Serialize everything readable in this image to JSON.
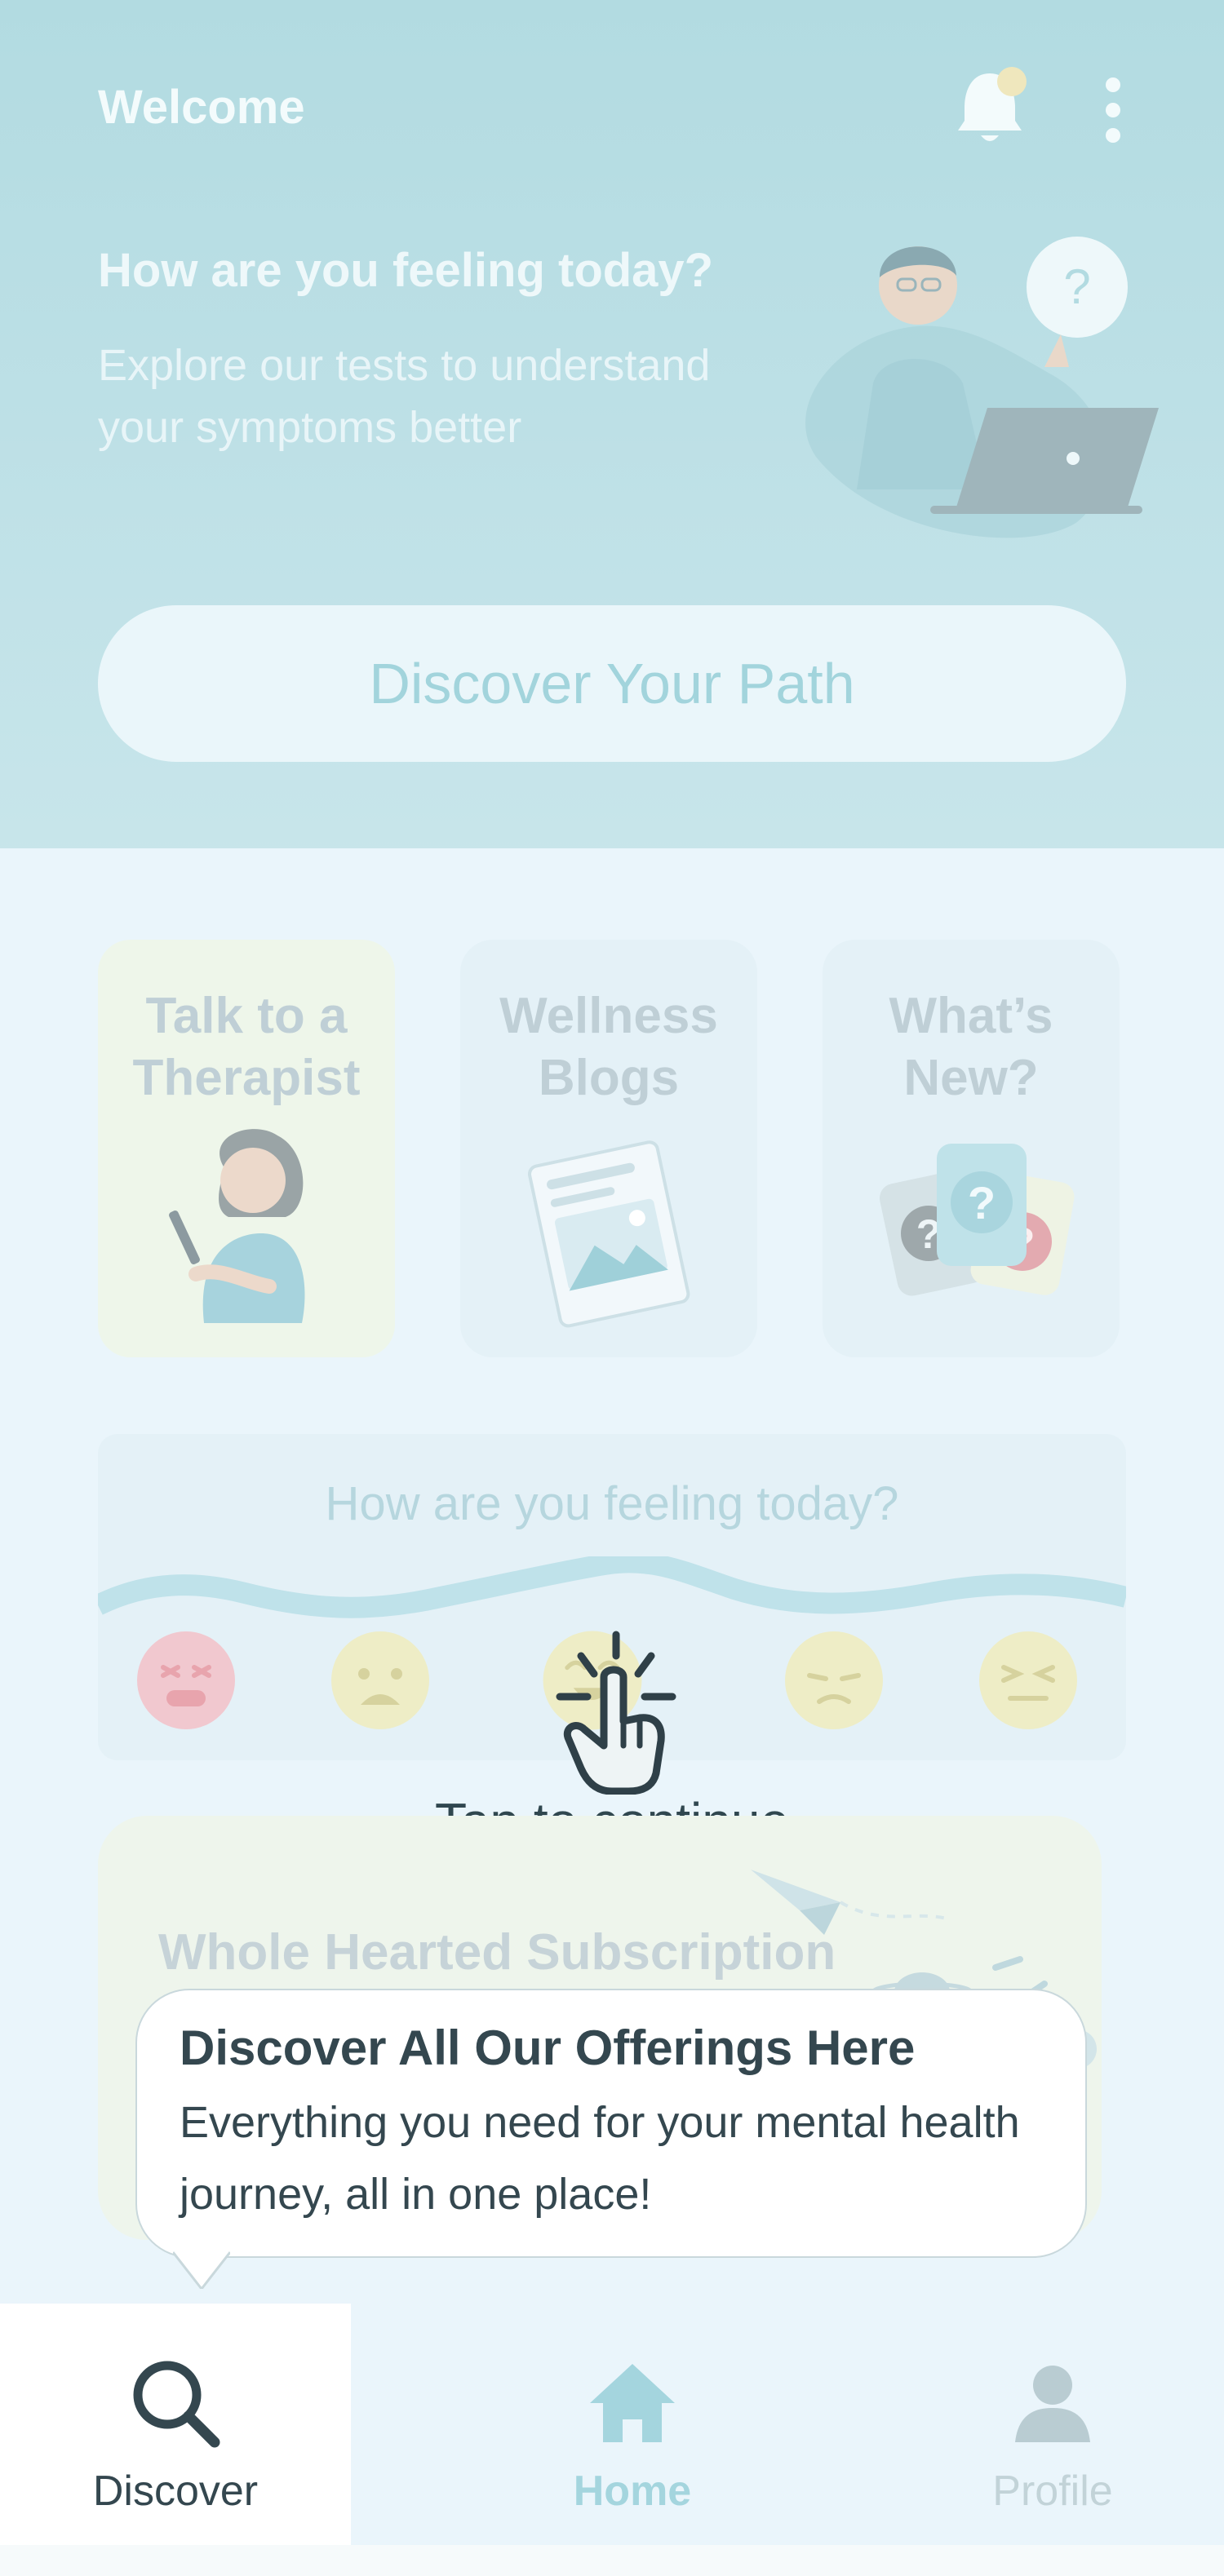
{
  "header": {
    "title": "Welcome"
  },
  "hero": {
    "question": "How are you feeling today?",
    "subtitle": "Explore our tests to understand your symptoms better",
    "cta_label": "Discover Your Path"
  },
  "cards": [
    {
      "title": "Talk to a Therapist"
    },
    {
      "title": "Wellness Blogs"
    },
    {
      "title": "What’s New?"
    }
  ],
  "mood": {
    "title": "How are you feeling today?",
    "emojis": [
      "angry-face-icon",
      "anxious-face-icon",
      "happy-face-icon",
      "sad-face-icon",
      "tired-face-icon"
    ]
  },
  "overlay": {
    "tap_label": "Tap to continue"
  },
  "subscription": {
    "title": "Whole Hearted Subscription"
  },
  "tooltip": {
    "title": "Discover All Our Offerings Here",
    "body": "Everything you need for your mental health journey, all in one place!"
  },
  "nav": {
    "items": [
      {
        "label": "Discover",
        "icon": "search-icon",
        "active": true
      },
      {
        "label": "Home",
        "icon": "home-icon",
        "active": false
      },
      {
        "label": "Profile",
        "icon": "profile-icon",
        "active": false
      }
    ]
  },
  "colors": {
    "hero": "#b2dbe1",
    "accent": "#a2d4dc",
    "dark_text": "#34474f",
    "background": "#eaf5fb"
  }
}
